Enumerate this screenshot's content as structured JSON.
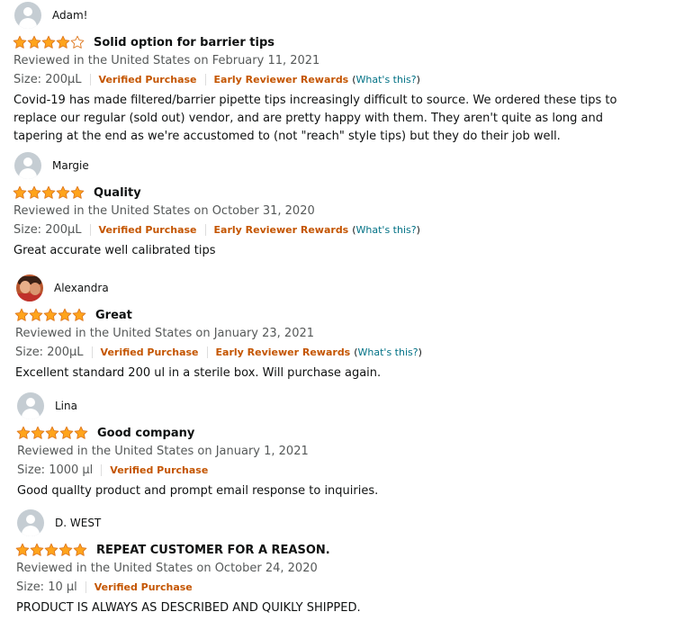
{
  "colors": {
    "star": "#ffa41c",
    "star_edge": "#de7921",
    "star_empty": "#ffffff",
    "badge": "#c45500",
    "link": "#007185"
  },
  "reviews": [
    {
      "name": "Adam!",
      "rating": 4,
      "title": "Solid option for barrier tips",
      "reviewed": "Reviewed in the United States on February 11, 2021",
      "size": "Size: 200µL",
      "verified": "Verified Purchase",
      "early": "Early Reviewer Rewards",
      "whats_this": "What's this?",
      "body": "Covid-19 has made filtered/barrier pipette tips increasingly difficult to source. We ordered these tips to replace our regular (sold out) vendor, and are pretty happy with them. They aren't quite as long and tapering at the end as we're accustomed to (not \"reach\" style tips) but they do their job well."
    },
    {
      "name": "Margie",
      "rating": 5,
      "title": "Quality",
      "reviewed": "Reviewed in the United States on October 31, 2020",
      "size": "Size: 200µL",
      "verified": "Verified Purchase",
      "early": "Early Reviewer Rewards",
      "whats_this": "What's this?",
      "body": "Great accurate well calibrated tips"
    },
    {
      "name": "Alexandra",
      "rating": 5,
      "title": "Great",
      "reviewed": "Reviewed in the United States on January 23, 2021",
      "size": "Size: 200µL",
      "verified": "Verified Purchase",
      "early": "Early Reviewer Rewards",
      "whats_this": "What's this?",
      "body": "Excellent standard 200 ul in a sterile box. Will purchase again."
    },
    {
      "name": "Lina",
      "rating": 5,
      "title": "Good company",
      "reviewed": "Reviewed in the United States on January 1, 2021",
      "size": "Size: 1000 µl",
      "verified": "Verified Purchase",
      "body": "Good quallty product and prompt email response to inquiries."
    },
    {
      "name": "D. WEST",
      "rating": 5,
      "title": "REPEAT CUSTOMER FOR A REASON.",
      "reviewed": "Reviewed in the United States on October 24, 2020",
      "size": "Size: 10 µl",
      "verified": "Verified Purchase",
      "body": "PRODUCT IS ALWAYS AS DESCRIBED AND QUIKLY SHIPPED."
    }
  ]
}
